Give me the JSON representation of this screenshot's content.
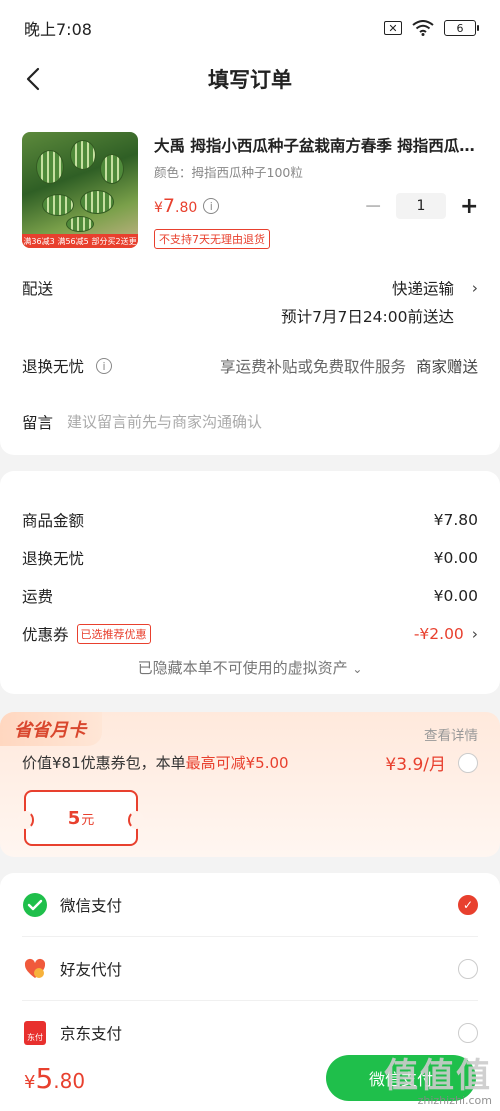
{
  "status": {
    "time": "晚上7:08",
    "battery": "6"
  },
  "nav": {
    "title": "填写订单"
  },
  "product": {
    "title": "大禹 拇指小西瓜种子盆栽南方春季 拇指西瓜种子",
    "spec": "颜色：拇指西瓜种子100粒",
    "price_symbol": "¥",
    "price_int": "7",
    "price_dec": ".80",
    "quantity": "1",
    "no_return_tag": "不支持7天无理由退货",
    "thumb_badges": [
      "满36减3",
      "满56减5",
      "部分买2送更"
    ]
  },
  "delivery": {
    "label": "配送",
    "method": "快递运输",
    "eta": "预计7月7日24:00前送达"
  },
  "return_service": {
    "label": "退换无忧",
    "desc": "享运费补贴或免费取件服务",
    "gift": "商家赠送"
  },
  "message": {
    "label": "留言",
    "placeholder": "建议留言前先与商家沟通确认"
  },
  "summary": {
    "rows": [
      {
        "label": "商品金额",
        "value": "¥7.80"
      },
      {
        "label": "退换无忧",
        "value": "¥0.00"
      },
      {
        "label": "运费",
        "value": "¥0.00"
      }
    ],
    "coupon_label": "优惠券",
    "coupon_tag": "已选推荐优惠",
    "coupon_value": "-¥2.00",
    "hidden_assets": "已隐藏本单不可使用的虚拟资产"
  },
  "monthly_card": {
    "badge": "省省月卡",
    "detail": "查看详情",
    "desc_prefix": "价值¥81优惠券包，本单",
    "desc_highlight": "最高可减¥5.00",
    "price": "¥3.9/月",
    "ticket_value": "5",
    "ticket_unit": "元"
  },
  "payment": {
    "methods": [
      {
        "label": "微信支付",
        "selected": true
      },
      {
        "label": "好友代付",
        "selected": false
      },
      {
        "label": "京东支付",
        "selected": false
      }
    ],
    "jd_icon_text": "东付"
  },
  "bottom": {
    "symbol": "¥",
    "total_int": "5",
    "total_dec": ".80",
    "pay_button": "微信支付"
  },
  "watermark": {
    "big": "值值值",
    "site": "zhizhizhi.com"
  },
  "colors": {
    "accent": "#e8402e",
    "wechat_green": "#1fbf4b"
  }
}
